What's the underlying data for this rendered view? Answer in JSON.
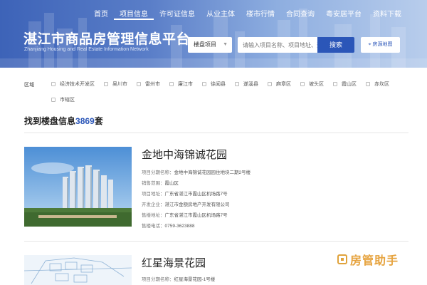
{
  "header": {
    "nav": [
      "首页",
      "项目信息",
      "许可证信息",
      "从业主体",
      "楼市行情",
      "合同查询",
      "粤安居平台",
      "资料下载"
    ],
    "active_nav_index": 1,
    "site_title": "湛江市商品房管理信息平台",
    "site_subtitle": "Zhanjiang Housing and Real Estate Information Network"
  },
  "search": {
    "type_value": "楼盘项目",
    "placeholder": "请输入项目名称、项目地址、开",
    "button_label": "搜索",
    "map_button_label": "房源地图"
  },
  "filter": {
    "label": "区域",
    "regions": [
      "经济技术开发区",
      "吴川市",
      "雷州市",
      "廉江市",
      "徐闻县",
      "遂溪县",
      "麻章区",
      "坡头区",
      "霞山区",
      "赤坎区",
      "市辖区"
    ]
  },
  "results": {
    "prefix": "找到楼盘信息",
    "count": "3869",
    "suffix": "套"
  },
  "listings": [
    {
      "title": "金地中海锦诚花园",
      "fields": [
        {
          "k": "项目分期名称：",
          "v": "金地中海锦诚花园园住地块二期2号楼"
        },
        {
          "k": "销售范围：",
          "v": "霞山区"
        },
        {
          "k": "项目地址：",
          "v": "广东省湛江市霞山区机场路7号"
        },
        {
          "k": "开发企业：",
          "v": "湛江市金额房地产开发有限公司"
        },
        {
          "k": "售楼地址：",
          "v": "广东省湛江市霞山区机场路7号"
        },
        {
          "k": "售楼电话：",
          "v": "0759-3623888"
        }
      ]
    },
    {
      "title": "红星海景花园",
      "fields": [
        {
          "k": "项目分期名称：",
          "v": "红星海景花园-1号楼"
        }
      ]
    }
  ],
  "watermark": "房管助手",
  "colors": {
    "accent": "#2b56b8",
    "watermark": "#e6a33e"
  }
}
